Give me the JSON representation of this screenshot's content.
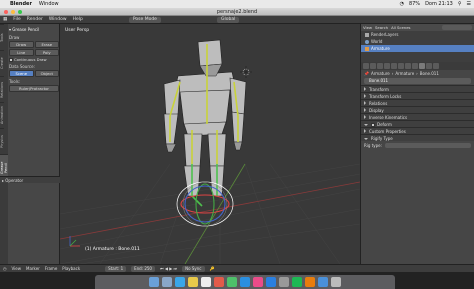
{
  "menubar": {
    "app": "Blender",
    "items": [
      "Window"
    ],
    "battery": "87%",
    "clock": "Dom 21:13"
  },
  "window_title": "persnaje2.blend",
  "infobar": {
    "items": [
      "File",
      "Render",
      "Window",
      "Help"
    ],
    "mode": "Pose Mode",
    "orientation": "Global"
  },
  "toolshelf": {
    "tabs": [
      "Tools",
      "Create",
      "Relations",
      "Animation",
      "Physics",
      "Grease Pencil"
    ],
    "section": "Grease Pencil",
    "draw_label": "Draw",
    "draw_buttons": [
      "Draw",
      "Erase"
    ],
    "line_buttons": [
      "Line",
      "Poly"
    ],
    "continuous_label": "Continuous Draw",
    "data_source_label": "Data Source:",
    "data_source_buttons": [
      "Scene",
      "Object"
    ],
    "tools_label": "Tools:",
    "ruler_label": "Ruler/Protractor",
    "operator_label": "Operator"
  },
  "viewport": {
    "label": "User Persp",
    "status": "(1) Armature : Bone.011"
  },
  "outliner": {
    "view_label": "View",
    "search_label": "Search",
    "scope": "All Scenes",
    "rows": [
      "RenderLayers",
      "World",
      "Armature"
    ]
  },
  "properties": {
    "path": [
      "Armature",
      "Armature",
      "Bone.011"
    ],
    "bone_name": "Bone.011",
    "panels": [
      {
        "label": "Transform",
        "open": false
      },
      {
        "label": "Transform Locks",
        "open": false
      },
      {
        "label": "Relations",
        "open": false
      },
      {
        "label": "Display",
        "open": false
      },
      {
        "label": "Inverse Kinematics",
        "open": false
      },
      {
        "label": "Deform",
        "open": true
      },
      {
        "label": "Custom Properties",
        "open": false
      },
      {
        "label": "Rigify Type",
        "open": true
      }
    ],
    "rig_type_label": "Rig type:"
  },
  "bottombar": {
    "items": [
      "View",
      "Marker",
      "Frame",
      "Playback"
    ],
    "start": "Start:",
    "start_val": "1",
    "end": "End:",
    "end_val": "250",
    "sync": "No Sync"
  },
  "colors": {
    "selection": "#5680c2",
    "viewport_bg": "#393939",
    "bone_yellow": "#c8d23a",
    "bone_green": "#4ec04e"
  }
}
